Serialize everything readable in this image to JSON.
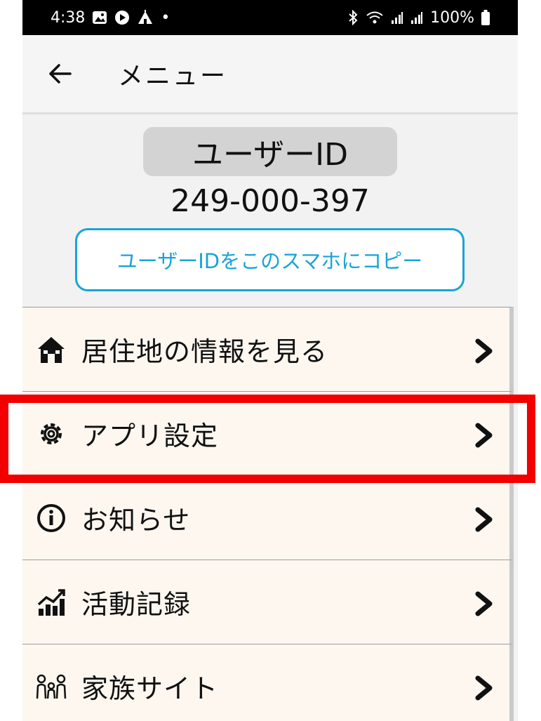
{
  "status_bar": {
    "time": "4:38",
    "left_icons": [
      "gallery-icon",
      "play-icon",
      "camp-icon"
    ],
    "dot": "•",
    "battery_text": "100%"
  },
  "header": {
    "title": "メニュー",
    "back_icon": "back-arrow-icon"
  },
  "user": {
    "id_label": "ユーザーID",
    "id_value": "249-000-397",
    "copy_button": "ユーザーIDをこのスマホにコピー"
  },
  "menu": {
    "items": [
      {
        "label": "居住地の情報を見る",
        "icon": "house-icon"
      },
      {
        "label": "アプリ設定",
        "icon": "gear-icon"
      },
      {
        "label": "お知らせ",
        "icon": "info-icon"
      },
      {
        "label": "活動記録",
        "icon": "chart-icon"
      },
      {
        "label": "家族サイト",
        "icon": "family-icon"
      }
    ]
  },
  "colors": {
    "accent": "#1aa3d8",
    "highlight": "#f20000",
    "menu_bg": "#fdf7f0"
  }
}
